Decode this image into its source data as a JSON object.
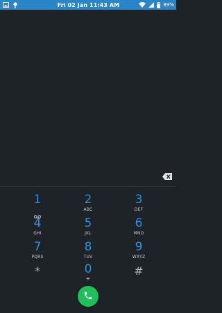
{
  "status_bar": {
    "datetime": "Fri 02 Jan 11:43 AM",
    "battery_percent": "89%",
    "left_icons": [
      "gallery-icon",
      "pin-icon"
    ],
    "right_icons": [
      "wifi-icon",
      "signal-icon",
      "battery-icon"
    ]
  },
  "dialer": {
    "number_display": "",
    "backspace_icon": "backspace-icon",
    "keys": [
      {
        "digit": "1",
        "letters": "",
        "extra_icon": "voicemail-icon"
      },
      {
        "digit": "2",
        "letters": "ABC"
      },
      {
        "digit": "3",
        "letters": "DEF"
      },
      {
        "digit": "4",
        "letters": "GHI"
      },
      {
        "digit": "5",
        "letters": "JKL"
      },
      {
        "digit": "6",
        "letters": "MNO"
      },
      {
        "digit": "7",
        "letters": "PQRS"
      },
      {
        "digit": "8",
        "letters": "TUV"
      },
      {
        "digit": "9",
        "letters": "WXYZ"
      },
      {
        "digit": "*",
        "letters": ""
      },
      {
        "digit": "0",
        "letters": "+"
      },
      {
        "digit": "#",
        "letters": ""
      }
    ],
    "call_button_icon": "phone-icon"
  },
  "colors": {
    "status_bar": "#2a85c8",
    "background": "#1e2328",
    "digit": "#2d8fd9",
    "call_button": "#1fbf5a"
  }
}
